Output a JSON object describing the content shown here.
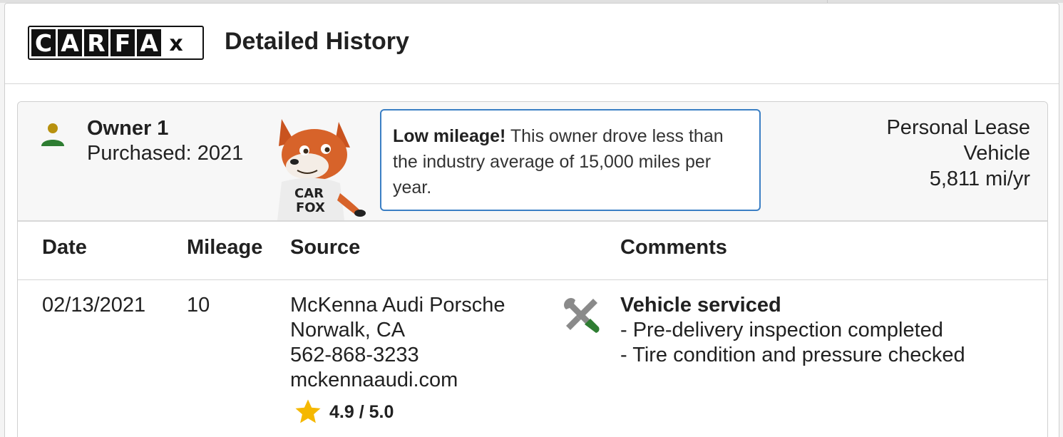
{
  "header": {
    "logo_letters": [
      "C",
      "A",
      "R",
      "F",
      "A",
      "x"
    ],
    "title": "Detailed History"
  },
  "owner": {
    "name": "Owner 1",
    "purchased": "Purchased: 2021",
    "icon": "person-icon",
    "mascot_shirt": [
      "CAR",
      "FOX"
    ],
    "callout_bold": "Low mileage!",
    "callout_text": " This owner drove less than the industry average of 15,000 miles per year.",
    "type_line1": "Personal Lease",
    "type_line2": "Vehicle",
    "mileage_per_year": "5,811 mi/yr"
  },
  "table": {
    "headers": {
      "date": "Date",
      "mileage": "Mileage",
      "source": "Source",
      "comments": "Comments"
    },
    "rows": [
      {
        "date": "02/13/2021",
        "mileage": "10",
        "source": [
          "McKenna Audi Porsche",
          "Norwalk, CA",
          "562-868-3233",
          "mckennaaudi.com"
        ],
        "rating": "4.9 / 5.0",
        "comment_icon": "wrench-screwdriver-icon",
        "comment_title": "Vehicle serviced",
        "comment_lines": [
          "- Pre-delivery inspection completed",
          "- Tire condition and pressure checked"
        ]
      }
    ]
  },
  "colors": {
    "callout_border": "#3b7fc4",
    "person_head": "#b8910f",
    "person_body": "#2e7d32",
    "star": "#f5b800",
    "wrench_handle": "#2e7d32",
    "tool_gray": "#8a8a8a"
  }
}
